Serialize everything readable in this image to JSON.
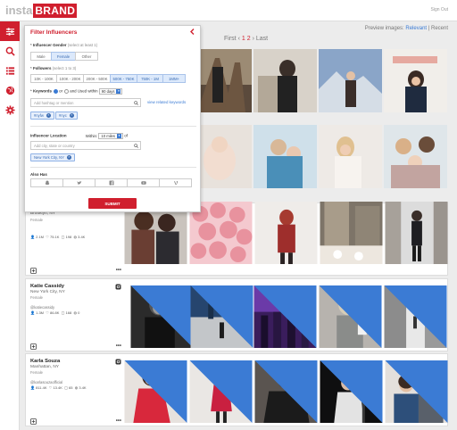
{
  "brand": {
    "prefix": "insta",
    "name": "BRAND"
  },
  "header": {
    "sign_out": "Sign Out"
  },
  "pagination": {
    "first": "First",
    "prev": "‹",
    "page1": "1",
    "page2": "2",
    "next": "›",
    "last": "Last"
  },
  "preview": {
    "label": "Preview images:",
    "relevant": "Relevant",
    "sep": "|",
    "recent": "Recent"
  },
  "filter": {
    "title": "Filter Influencers",
    "gender": {
      "label": "Influencer Gender",
      "hint": "(select at least 1)",
      "options": [
        "Male",
        "Female",
        "Other"
      ],
      "selected": "Female"
    },
    "followers": {
      "label": "Followers",
      "hint": "(select 1 to 3)",
      "options": [
        "10K - 100K",
        "100K - 200K",
        "200K - 500K",
        "500K - 750K",
        "750K - 1M",
        "1MM+"
      ],
      "selected": [
        "500K - 750K",
        "750K - 1MM",
        "1MM+"
      ]
    },
    "keywords": {
      "label": "Keywords",
      "or": "or",
      "and": "and",
      "used_within": "Used within",
      "days": "90 days",
      "placeholder": "Add hashtag or mention",
      "related": "view related keywords",
      "chips": [
        "#nyfw",
        "#nyc"
      ]
    },
    "location": {
      "label": "Influencer Location",
      "within": "Within:",
      "miles": "10 miles",
      "of": "of",
      "placeholder": "Add city, state or country",
      "chip": "New York City, NY"
    },
    "also_has": {
      "label": "Also Has"
    },
    "submit": "SUBMIT"
  },
  "influencers": [
    {
      "name": "",
      "location": "Brooklyn, NY",
      "gender": "Female",
      "handle": "",
      "followers": "2.1M",
      "likes": "75.1K",
      "comments": "198",
      "engagement": "3.4K"
    },
    {
      "name": "Katie Cassidy",
      "location": "New York City, NY",
      "gender": "Female",
      "handle": "@katiecassidy",
      "followers": "1.3M",
      "likes": "86.8K",
      "comments": "168",
      "engagement": "0"
    },
    {
      "name": "Karla Souza",
      "location": "Manhattan, NY",
      "gender": "Female",
      "handle": "@karlasouzaofficial",
      "followers": "811.4K",
      "likes": "13.4K",
      "comments": "65",
      "engagement": "3.4K"
    }
  ],
  "colors": {
    "accent": "#d01f2e",
    "link": "#3b7bd4",
    "chip_bg": "#e7effb"
  }
}
